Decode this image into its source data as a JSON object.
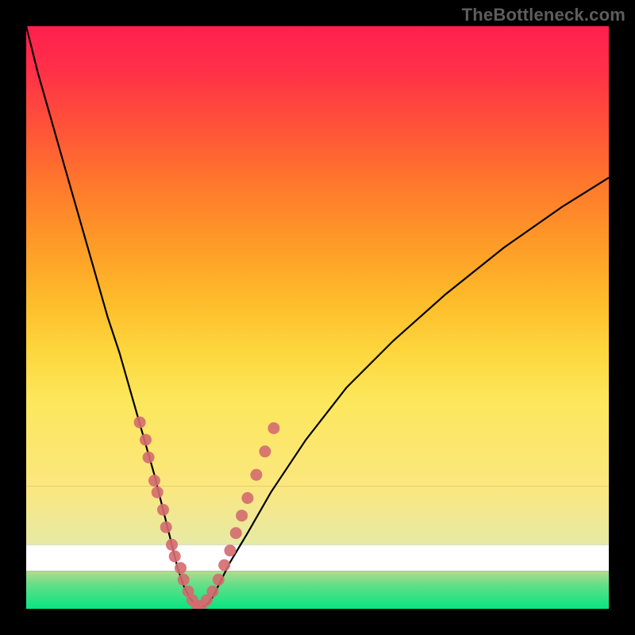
{
  "watermark": "TheBottleneck.com",
  "colors": {
    "frame": "#000000",
    "curve": "#000000",
    "marker_fill": "#d46a6f",
    "marker_stroke": "#d46a6f",
    "band_top": "#fbe77e",
    "band_bottom": "#e6eaa5",
    "green_top": "#b6db8e",
    "green_bottom": "#03e580"
  },
  "gradient_stops": [
    {
      "offset": 0.0,
      "color": "#ff1f4e"
    },
    {
      "offset": 0.1,
      "color": "#ff3148"
    },
    {
      "offset": 0.22,
      "color": "#ff5338"
    },
    {
      "offset": 0.35,
      "color": "#ff7a2c"
    },
    {
      "offset": 0.47,
      "color": "#fe9a27"
    },
    {
      "offset": 0.59,
      "color": "#feba2a"
    },
    {
      "offset": 0.71,
      "color": "#fdd73d"
    },
    {
      "offset": 0.81,
      "color": "#fce75b"
    },
    {
      "offset": 1.0,
      "color": "#fbe77e"
    }
  ],
  "chart_data": {
    "type": "line",
    "title": "",
    "xlabel": "",
    "ylabel": "",
    "xlim": [
      0,
      100
    ],
    "ylim": [
      0,
      100
    ],
    "series": [
      {
        "name": "bottleneck-curve",
        "x": [
          0,
          2,
          4,
          6,
          8,
          10,
          12,
          14,
          16,
          18,
          20,
          22,
          23,
          24,
          25,
          26,
          27,
          28,
          29,
          30,
          31,
          32,
          33,
          35,
          38,
          42,
          48,
          55,
          63,
          72,
          82,
          92,
          100
        ],
        "y": [
          100,
          92,
          85,
          78,
          71,
          64,
          57,
          50,
          44,
          37,
          30,
          23,
          19,
          15,
          11,
          7,
          4,
          2,
          0.7,
          0.2,
          0.7,
          2,
          4,
          8,
          13,
          20,
          29,
          38,
          46,
          54,
          62,
          69,
          74
        ]
      }
    ],
    "markers": [
      {
        "x": 19.5,
        "y": 32
      },
      {
        "x": 20.5,
        "y": 29
      },
      {
        "x": 21.0,
        "y": 26
      },
      {
        "x": 22.0,
        "y": 22
      },
      {
        "x": 22.5,
        "y": 20
      },
      {
        "x": 23.5,
        "y": 17
      },
      {
        "x": 24.0,
        "y": 14
      },
      {
        "x": 25.0,
        "y": 11
      },
      {
        "x": 25.5,
        "y": 9
      },
      {
        "x": 26.5,
        "y": 7
      },
      {
        "x": 27.0,
        "y": 5
      },
      {
        "x": 27.8,
        "y": 3
      },
      {
        "x": 28.5,
        "y": 1.5
      },
      {
        "x": 29.3,
        "y": 0.5
      },
      {
        "x": 30.0,
        "y": 0.5
      },
      {
        "x": 31.0,
        "y": 1.5
      },
      {
        "x": 32.0,
        "y": 3
      },
      {
        "x": 33.0,
        "y": 5
      },
      {
        "x": 34.0,
        "y": 7.5
      },
      {
        "x": 35.0,
        "y": 10
      },
      {
        "x": 36.0,
        "y": 13
      },
      {
        "x": 37.0,
        "y": 16
      },
      {
        "x": 38.0,
        "y": 19
      },
      {
        "x": 39.5,
        "y": 23
      },
      {
        "x": 41.0,
        "y": 27
      },
      {
        "x": 42.5,
        "y": 31
      }
    ],
    "bands": [
      {
        "name": "yellow-band",
        "y0": 79,
        "y1": 89
      },
      {
        "name": "green-band",
        "y0": 93.5,
        "y1": 100
      }
    ]
  }
}
